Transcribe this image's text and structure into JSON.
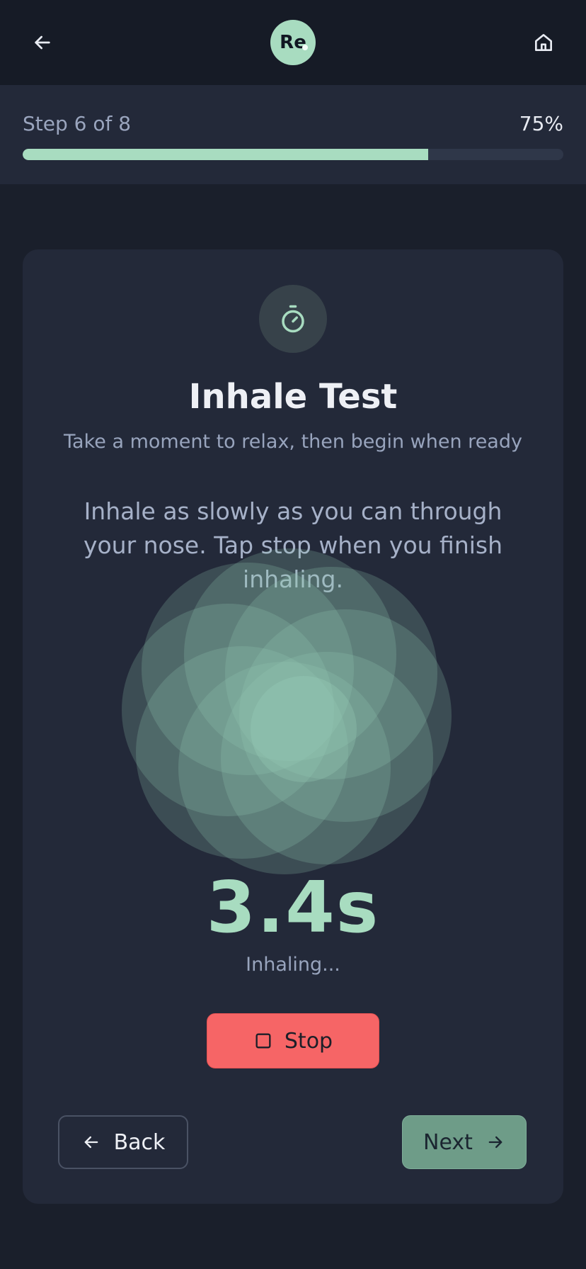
{
  "header": {
    "logo_text": "Re",
    "back_icon": "arrow-left-icon",
    "home_icon": "home-icon"
  },
  "progress": {
    "step_label": "Step 6 of 8",
    "percent_label": "75%",
    "fraction": 0.75
  },
  "test": {
    "icon": "stopwatch-icon",
    "title": "Inhale Test",
    "subtitle": "Take a moment to relax, then begin when ready",
    "instruction": "Inhale as slowly as you can through your nose. Tap stop when you finish inhaling.",
    "timer_value": "3.4s",
    "status": "Inhaling...",
    "stop_label": "Stop"
  },
  "navigation": {
    "back_label": "Back",
    "next_label": "Next"
  },
  "colors": {
    "accent": "#a8dcc0",
    "stop": "#f66566",
    "next_button": "#6e9c88",
    "background": "#1a1f2b",
    "card": "#232939"
  }
}
